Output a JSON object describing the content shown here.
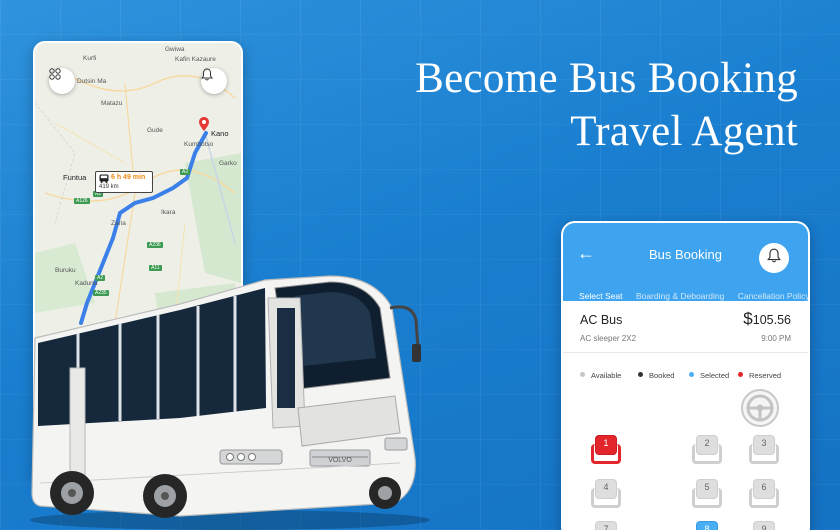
{
  "headline": {
    "line1": "Become Bus Booking",
    "line2": "Travel Agent"
  },
  "map": {
    "towns": [
      {
        "name": "Gwiwa",
        "cls": ""
      },
      {
        "name": "Kafin Kazaure",
        "cls": ""
      },
      {
        "name": "Kurfi",
        "cls": ""
      },
      {
        "name": "Dutsin Ma",
        "cls": ""
      },
      {
        "name": "Matazu",
        "cls": ""
      },
      {
        "name": "Gude",
        "cls": ""
      },
      {
        "name": "Kano",
        "cls": "big"
      },
      {
        "name": "Kumbotso",
        "cls": ""
      },
      {
        "name": "Funtua",
        "cls": "big"
      },
      {
        "name": "Zaria",
        "cls": ""
      },
      {
        "name": "Ikara",
        "cls": ""
      },
      {
        "name": "Garko",
        "cls": ""
      },
      {
        "name": "Buruku",
        "cls": ""
      },
      {
        "name": "Kaduna",
        "cls": ""
      }
    ],
    "roads": [
      "A2",
      "A126",
      "A2",
      "A236",
      "A11",
      "A2",
      "A235"
    ],
    "trip_time": "6 h 49 min",
    "trip_distance": "419 km"
  },
  "booking": {
    "title": "Bus Booking",
    "back": "←",
    "tabs": [
      "Select Seat",
      "Boarding & Deboarding",
      "Cancellation Policy"
    ],
    "bus_name": "AC Bus",
    "bus_type": "AC sleeper 2X2",
    "currency": "$",
    "price": "105.56",
    "time": "9:00 PM",
    "legend": [
      {
        "label": "Available",
        "color": "#c6c6c6"
      },
      {
        "label": "Booked",
        "color": "#333333"
      },
      {
        "label": "Selected",
        "color": "#4aaef5"
      },
      {
        "label": "Reserved",
        "color": "#e3262b"
      }
    ],
    "seats": [
      {
        "num": "1",
        "state": "booked"
      },
      {
        "num": "2",
        "state": "available"
      },
      {
        "num": "3",
        "state": "available"
      },
      {
        "num": "4",
        "state": "available"
      },
      {
        "num": "5",
        "state": "available"
      },
      {
        "num": "6",
        "state": "available"
      },
      {
        "num": "7",
        "state": "available"
      },
      {
        "num": "8",
        "state": "selected"
      },
      {
        "num": "9",
        "state": "available"
      }
    ]
  }
}
